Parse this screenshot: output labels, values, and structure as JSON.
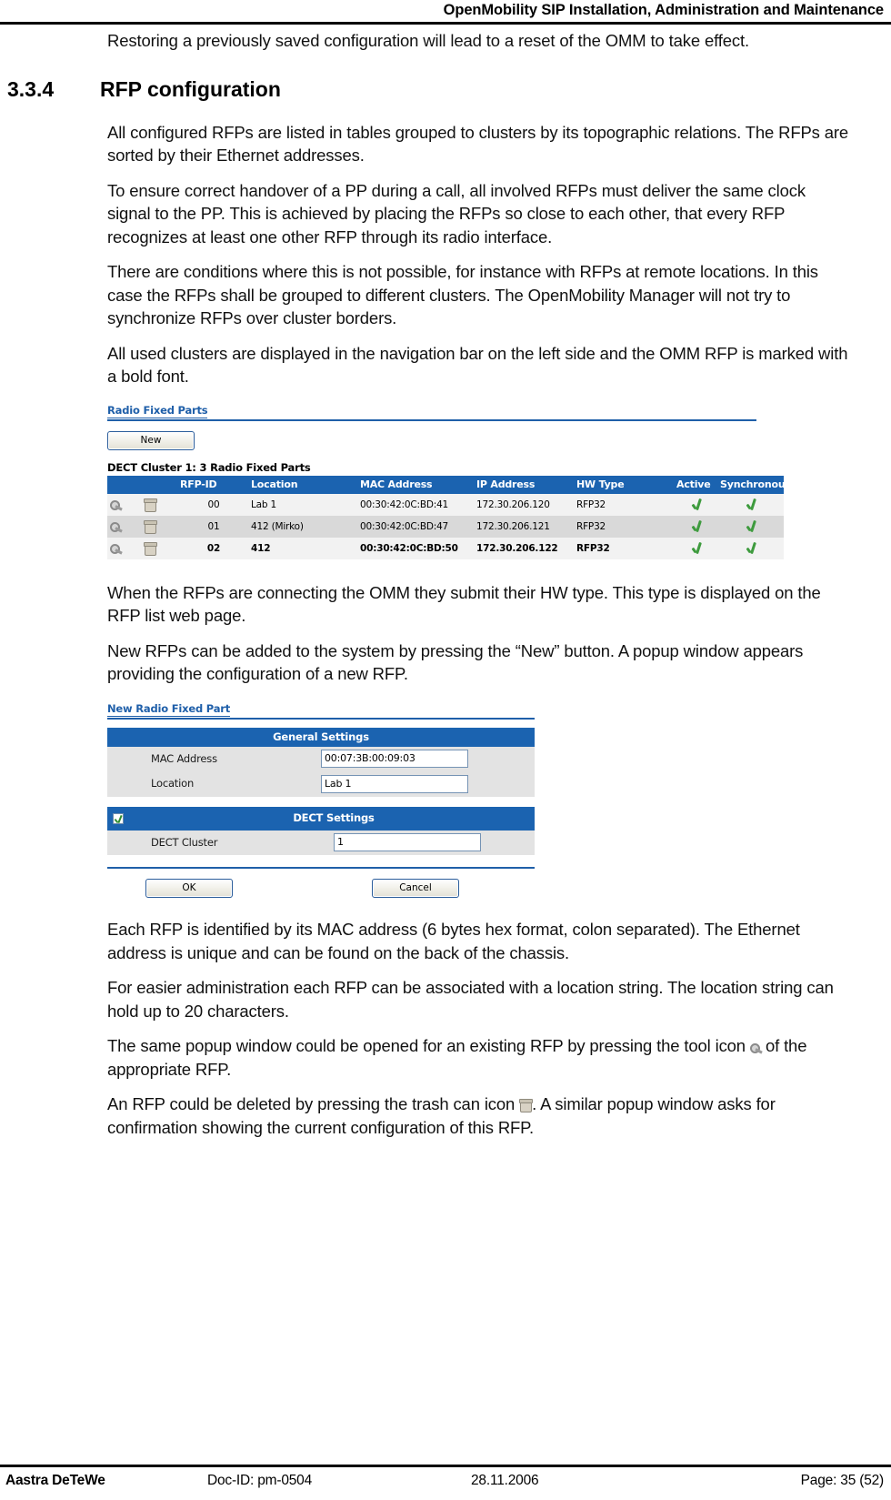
{
  "header": {
    "title": "OpenMobility SIP Installation, Administration and Maintenance"
  },
  "intro_paragraph": "Restoring a previously saved configuration will lead to a reset of the OMM to take effect.",
  "section": {
    "number": "3.3.4",
    "title": "RFP configuration"
  },
  "paragraphs": {
    "p1": "All configured RFPs are listed in tables grouped to clusters by its topographic relations. The RFPs are sorted by their Ethernet addresses.",
    "p2": "To ensure correct handover of a PP during a call, all involved RFPs must deliver the same clock signal to the PP. This is achieved by placing the RFPs so close to each other, that every RFP recognizes at least one other RFP through its radio interface.",
    "p3": "There are conditions where this is not possible, for instance with RFPs at remote locations. In this case the RFPs shall be grouped to different clusters. The OpenMobility Manager will not try to synchronize RFPs over cluster borders.",
    "p4": "All used clusters are displayed in the navigation bar on the left side and the OMM RFP is marked with a bold font.",
    "p5": "When the RFPs are connecting the OMM they submit their HW type. This type is displayed on the RFP list web page.",
    "p6": "New RFPs can be added to the system by pressing the “New” button. A popup window appears providing the configuration of a new RFP.",
    "p7": "Each RFP is identified by its MAC address (6 bytes hex format, colon separated). The Ethernet address is unique and can be found on the back of the chassis.",
    "p8": "For easier administration each RFP can be associated with a location string. The location string can hold up to 20 characters.",
    "p9a": "The same popup window could be opened for an existing RFP by pressing the tool icon",
    "p9b": "of the appropriate RFP.",
    "p10a": "An RFP could be deleted by pressing the trash can icon",
    "p10b": ". A similar popup window asks for confirmation showing the current configuration of this RFP."
  },
  "rfp_screenshot": {
    "title": "Radio Fixed Parts",
    "new_button": "New",
    "cluster_caption": "DECT Cluster 1: 3 Radio Fixed Parts",
    "columns": {
      "tool": "",
      "trash": "",
      "rfp_id": "RFP-ID",
      "location": "Location",
      "mac_address": "MAC Address",
      "ip_address": "IP Address",
      "hw_type": "HW Type",
      "active": "Active",
      "synchronous": "Synchronous"
    },
    "rows": [
      {
        "rfp_id": "00",
        "location": "Lab 1",
        "mac_address": "00:30:42:0C:BD:41",
        "ip_address": "172.30.206.120",
        "hw_type": "RFP32",
        "active": "check",
        "synchronous": "check",
        "bold": false
      },
      {
        "rfp_id": "01",
        "location": "412 (Mirko)",
        "mac_address": "00:30:42:0C:BD:47",
        "ip_address": "172.30.206.121",
        "hw_type": "RFP32",
        "active": "check",
        "synchronous": "check",
        "bold": false
      },
      {
        "rfp_id": "02",
        "location": "412",
        "mac_address": "00:30:42:0C:BD:50",
        "ip_address": "172.30.206.122",
        "hw_type": "RFP32",
        "active": "check",
        "synchronous": "check",
        "bold": true
      }
    ]
  },
  "new_rfp_dialog": {
    "title": "New Radio Fixed Part",
    "general_settings_header": "General Settings",
    "mac_address_label": "MAC Address",
    "mac_address_value": "00:07:3B:00:09:03",
    "location_label": "Location",
    "location_value": "Lab 1",
    "dect_settings_header": "DECT Settings",
    "dect_cluster_label": "DECT Cluster",
    "dect_cluster_value": "1",
    "ok_button": "OK",
    "cancel_button": "Cancel"
  },
  "footer": {
    "company": "Aastra DeTeWe",
    "doc_id": "Doc-ID: pm-0504",
    "date": "28.11.2006",
    "page": "Page: 35 (52)"
  },
  "colors": {
    "header_blue": "#1B63B0",
    "link_blue": "#1F5FA9",
    "row_odd": "#F2F2F2",
    "row_even": "#D9D9D9",
    "check_green": "#3E9B3E"
  }
}
